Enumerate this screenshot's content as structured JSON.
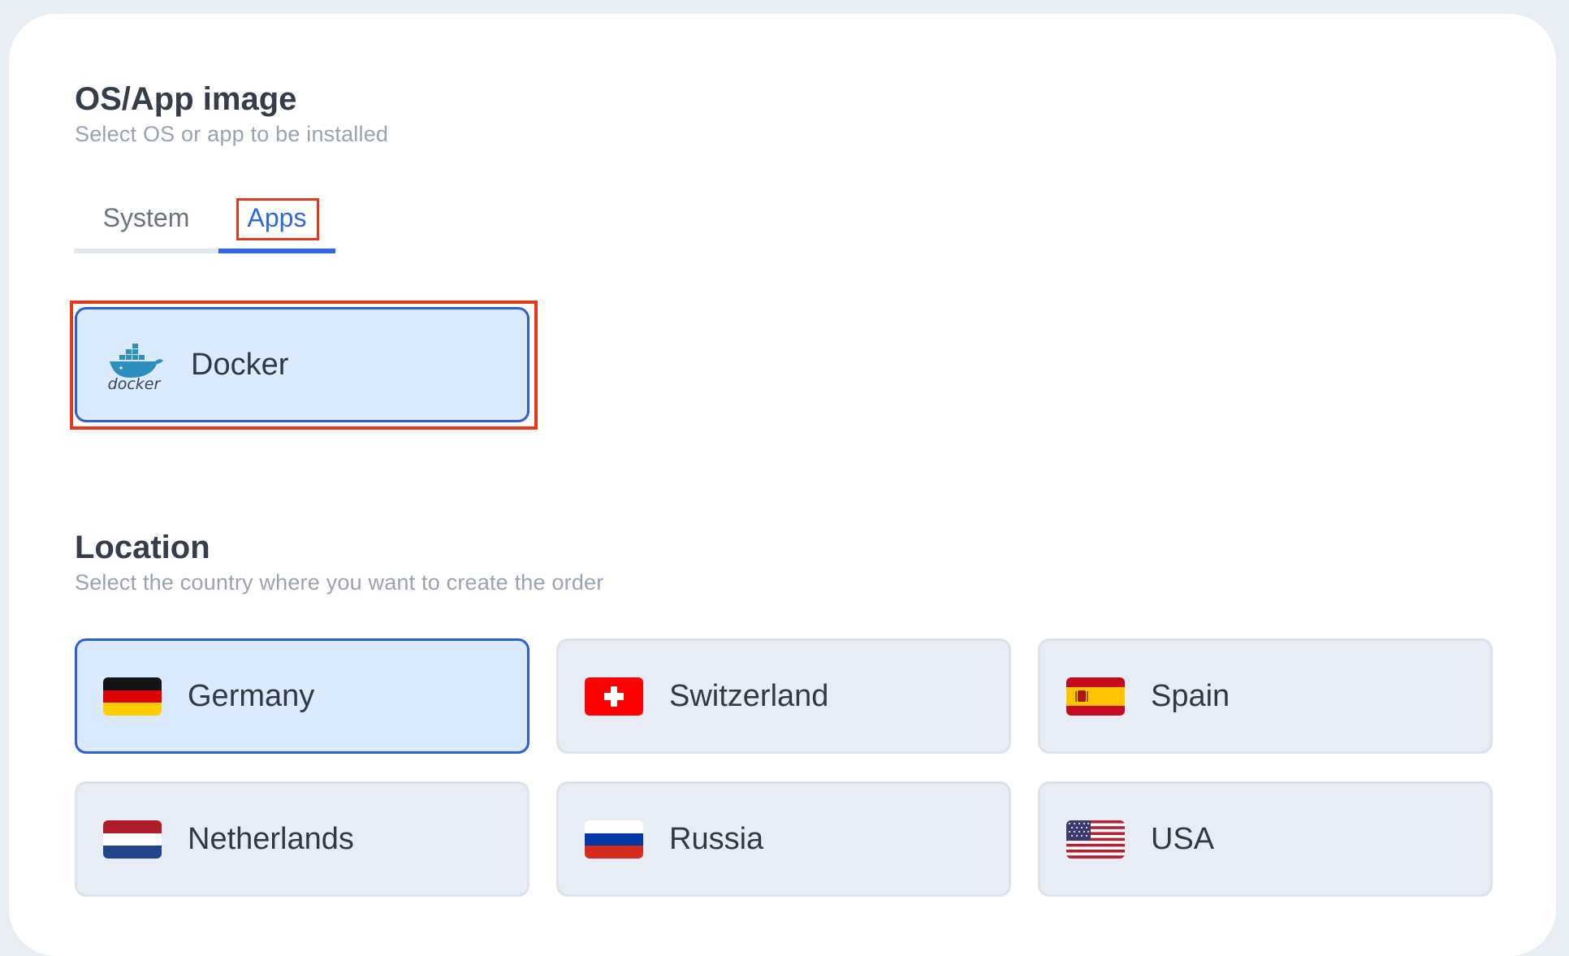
{
  "os_section": {
    "title": "OS/App image",
    "subtitle": "Select OS or app to be installed",
    "tabs": [
      {
        "label": "System",
        "active": false
      },
      {
        "label": "Apps",
        "active": true
      }
    ],
    "apps": [
      {
        "label": "Docker",
        "icon": "docker-icon",
        "logo_text": "docker",
        "selected": true
      }
    ]
  },
  "location_section": {
    "title": "Location",
    "subtitle": "Select the country where you want to create the order",
    "countries": [
      {
        "label": "Germany",
        "icon": "germany-flag-icon",
        "selected": true
      },
      {
        "label": "Switzerland",
        "icon": "switzerland-flag-icon",
        "selected": false
      },
      {
        "label": "Spain",
        "icon": "spain-flag-icon",
        "selected": false
      },
      {
        "label": "Netherlands",
        "icon": "netherlands-flag-icon",
        "selected": false
      },
      {
        "label": "Russia",
        "icon": "russia-flag-icon",
        "selected": false
      },
      {
        "label": "USA",
        "icon": "usa-flag-icon",
        "selected": false
      }
    ]
  },
  "colors": {
    "accent": "#3166e5",
    "selected_bg": "#dbeafc",
    "selected_border": "#2c5fd2",
    "tile_bg": "#e8edf5",
    "highlight_red": "#e3381b"
  }
}
